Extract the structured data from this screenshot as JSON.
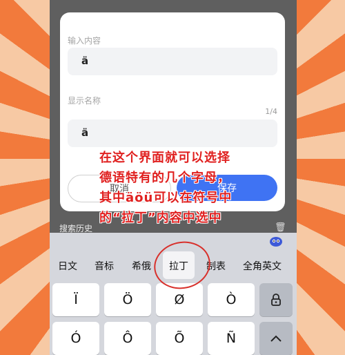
{
  "dialog": {
    "input_label": "输入内容",
    "input_value": "ä",
    "display_label": "显示名称",
    "display_value": "ä",
    "counter": "1/4",
    "cancel_label": "取消",
    "save_label": "保存"
  },
  "history": {
    "label": "搜索历史"
  },
  "keyboard": {
    "tabs": [
      "日文",
      "音标",
      "希俄",
      "拉丁",
      "制表",
      "全角英文"
    ],
    "active_tab": "拉丁",
    "row1": [
      "Ï",
      "Ö",
      "Ø",
      "Ò"
    ],
    "row2": [
      "Ó",
      "Ô",
      "Õ",
      "Ñ"
    ]
  },
  "annotation": {
    "text": "在这个界面就可以选择\n德语特有的几个字母，\n其中äöü可以在符号中\n的“拉丁”内容中选中"
  },
  "colors": {
    "accent": "#3f73f3",
    "annotation": "#e0201f"
  }
}
